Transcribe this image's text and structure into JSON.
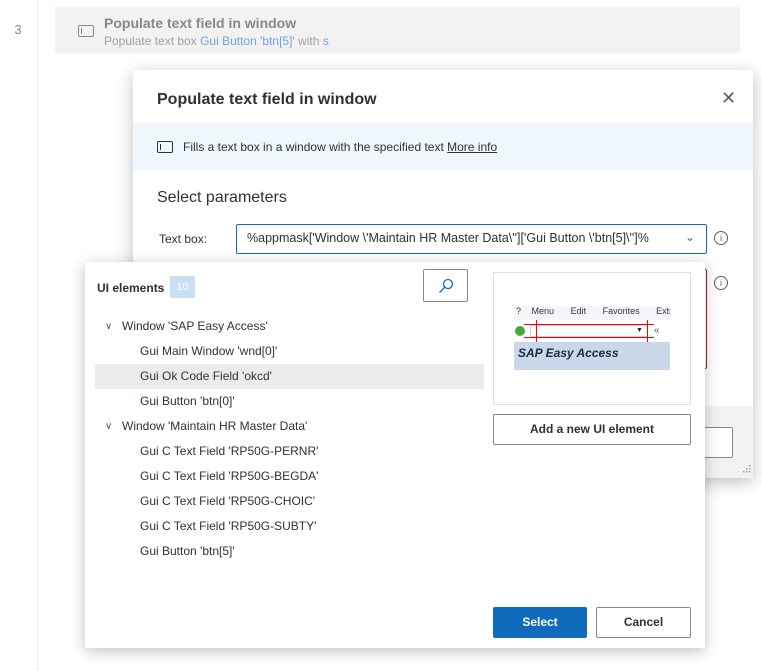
{
  "editor": {
    "line_number": "3"
  },
  "action_card": {
    "title": "Populate text field in window",
    "sub_prefix": "Populate text box ",
    "sub_element": "Gui Button 'btn[5]'",
    "sub_with": " with ",
    "sub_value": "s"
  },
  "dialog": {
    "title": "Populate text field in window",
    "close": "✕",
    "description": "Fills a text box in a window with the specified text ",
    "more_info": "More info",
    "section": "Select parameters",
    "text_box_label": "Text box:",
    "text_box_value": "%appmask['Window \\'Maintain HR Master Data\\'']['Gui Button \\'btn[5]\\'']%"
  },
  "picker": {
    "title": "UI elements",
    "count": "10",
    "tree": [
      {
        "label": "Window 'SAP Easy Access'",
        "level": 0
      },
      {
        "label": "Gui Main Window 'wnd[0]'",
        "level": 1
      },
      {
        "label": "Gui Ok Code Field 'okcd'",
        "level": 1,
        "selected": true
      },
      {
        "label": "Gui Button 'btn[0]'",
        "level": 1
      },
      {
        "label": "Window 'Maintain HR Master Data'",
        "level": 0
      },
      {
        "label": "Gui C Text Field 'RP50G-PERNR'",
        "level": 1
      },
      {
        "label": "Gui C Text Field 'RP50G-BEGDA'",
        "level": 1
      },
      {
        "label": "Gui C Text Field 'RP50G-CHOIC'",
        "level": 1
      },
      {
        "label": "Gui C Text Field 'RP50G-SUBTY'",
        "level": 1
      },
      {
        "label": "Gui Button 'btn[5]'",
        "level": 1
      }
    ],
    "preview": {
      "menu": [
        "Menu",
        "Edit",
        "Favorites",
        "Extr"
      ],
      "banner": "SAP Easy Access"
    },
    "add_button": "Add a new UI element",
    "select_button": "Select",
    "cancel_button": "Cancel"
  }
}
